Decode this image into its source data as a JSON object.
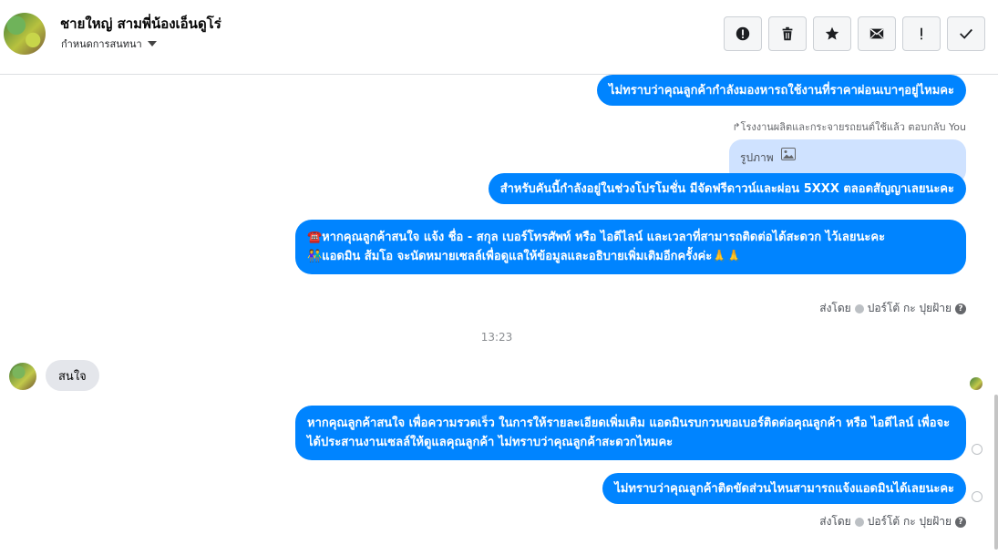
{
  "header": {
    "contact_name": "ชายใหญ่ สามพี่น้องเอ็นดูโร่",
    "manage_label": "กำหนดการสนทนา",
    "actions": [
      {
        "name": "report-icon",
        "glyph": "!"
      },
      {
        "name": "trash-icon",
        "glyph": "trash"
      },
      {
        "name": "star-icon",
        "glyph": "star"
      },
      {
        "name": "mail-icon",
        "glyph": "mail"
      },
      {
        "name": "exclamation-icon",
        "glyph": "!"
      },
      {
        "name": "check-icon",
        "glyph": "check"
      }
    ]
  },
  "messages": {
    "m1": "ไม่ทราบว่าคุณลูกค้ากำลังมองหารถใช้งานที่ราคาผ่อนเบาๆอยู่ไหมคะ",
    "reply_note": "↱โรงงานผลิตและกระจายรถยนต์ใช้แล้ว ตอบกลับ You",
    "reply_ref_label": "รูปภาพ",
    "m2": "สำหรับคันนี้กำลังอยู่ในช่วงโปรโมชั่น มีจัดฟรีดาวน์และผ่อน 5XXX ตลอดสัญญาเลยนะคะ",
    "m3_line1": "☎️หากคุณลูกค้าสนใจ แจ้ง ชื่อ - สกุล เบอร์โทรศัพท์ หรือ ไอดีไลน์ และเวลาที่สามารถติดต่อได้สะดวก ไว้เลยนะคะ",
    "m3_line2": "👫แอดมิน ส้มโอ จะนัดหมายเซลล์เพื่อดูแลให้ข้อมูลและอธิบายเพิ่มเติมอีกครั้งค่ะ🙏🙏",
    "sent_by_1": "ส่งโดย",
    "sender_1": "ปอร์โต้ กะ ปุยฝ้าย",
    "timestamp": "13:23",
    "incoming": "สนใจ",
    "m4": "หากคุณลูกค้าสนใจ เพื่อความรวดเร็ว ในการให้รายละเอียดเพิ่มเติม แอดมินรบกวนขอเบอร์ติดต่อคุณลูกค้า หรือ ไอดีไลน์ เพื่อจะได้ประสานงานเซลล์ให้ดูแลคุณลูกค้า ไม่ทราบว่าคุณลูกค้าสะดวกไหมคะ",
    "m5": "ไม่ทราบว่าคุณลูกค้าติดขัดส่วนไหนสามารถแจ้งแอดมินได้เลยนะคะ",
    "sent_by_2": "ส่งโดย",
    "sender_2": "ปอร์โต้ กะ ปุยฝ้าย"
  },
  "colors": {
    "bubble_blue": "#0084ff",
    "incoming_gray": "#e4e6eb",
    "reply_ref_bg": "#cfe2ff"
  }
}
